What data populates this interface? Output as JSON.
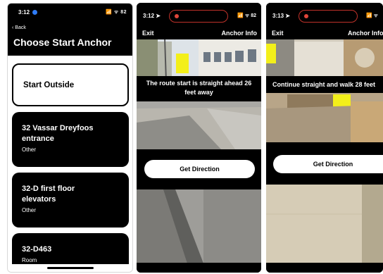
{
  "screen1": {
    "status_time": "3:12",
    "status_icons": "📶 ᯤ 82",
    "back_label": "‹ Back",
    "title": "Choose Start Anchor",
    "anchors": [
      {
        "name": "Start Outside",
        "sub": ""
      },
      {
        "name": "32 Vassar Dreyfoos entrance",
        "sub": "Other"
      },
      {
        "name": "32-D first floor elevators",
        "sub": "Other"
      },
      {
        "name": "32-D463",
        "sub": "Room"
      }
    ]
  },
  "screen2": {
    "status_time": "3:12 ➤",
    "status_icons": "📶 ᯤ 82",
    "exit_label": "Exit",
    "info_label": "Anchor Info",
    "instruction": "The route start is straight ahead 26 feet away",
    "direction_button": "Get Direction"
  },
  "screen3": {
    "status_time": "3:13 ➤",
    "status_icons": "📶 ᯤ",
    "exit_label": "Exit",
    "info_label": "Anchor Info",
    "instruction": "Continue straight and walk 28 feet",
    "direction_button": "Get Direction"
  },
  "colors": {
    "accent_yellow": "#f3ef1a",
    "recording_red": "#e0463a",
    "location_blue": "#2f7cf6"
  }
}
